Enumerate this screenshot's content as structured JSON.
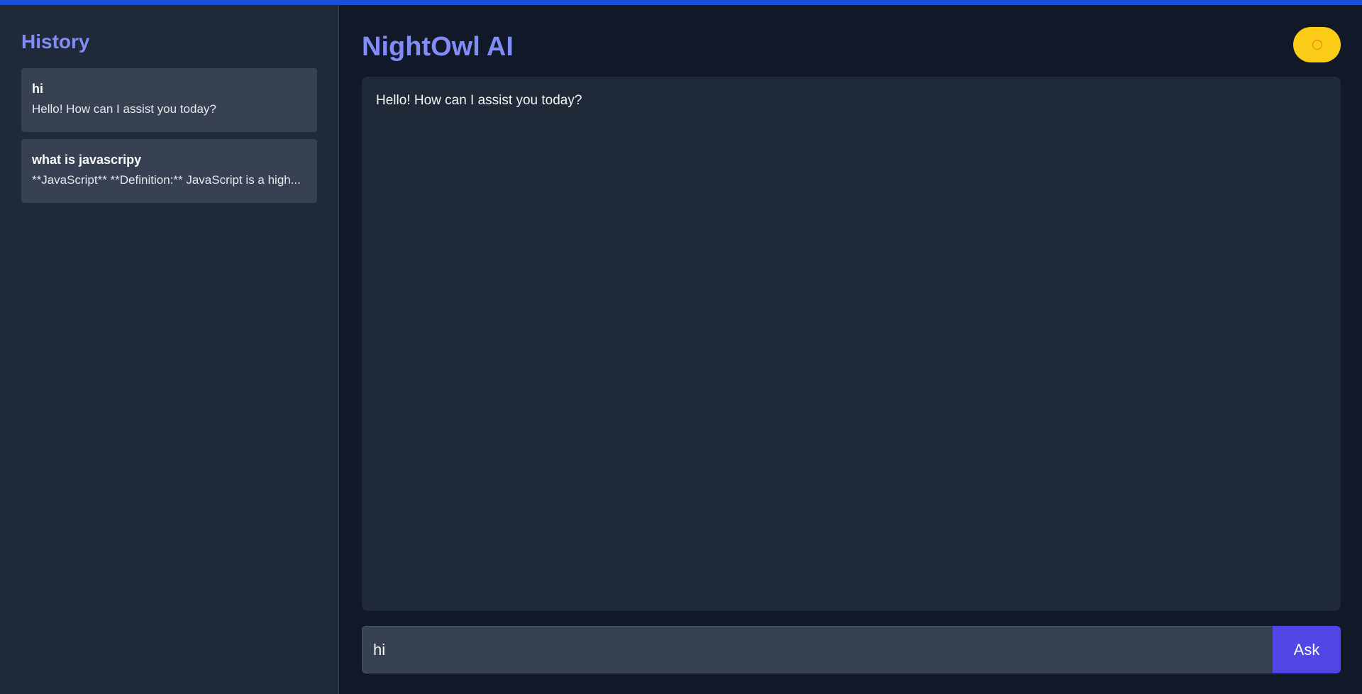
{
  "sidebar": {
    "title": "History",
    "items": [
      {
        "question": "hi",
        "answer": "Hello! How can I assist you today?"
      },
      {
        "question": "what is javascripy",
        "answer": "**JavaScript** **Definition:** JavaScript is a high..."
      }
    ]
  },
  "header": {
    "title": "NightOwl AI",
    "theme_toggle_icon": "sun-icon"
  },
  "chat": {
    "messages": [
      {
        "role": "assistant",
        "text": "Hello! How can I assist you today?"
      }
    ]
  },
  "composer": {
    "input_value": "hi",
    "ask_label": "Ask"
  },
  "colors": {
    "accent": "#818cf8",
    "button": "#4f46e5",
    "toggle": "#facc15",
    "background": "#111827",
    "panel": "#1f2937"
  }
}
